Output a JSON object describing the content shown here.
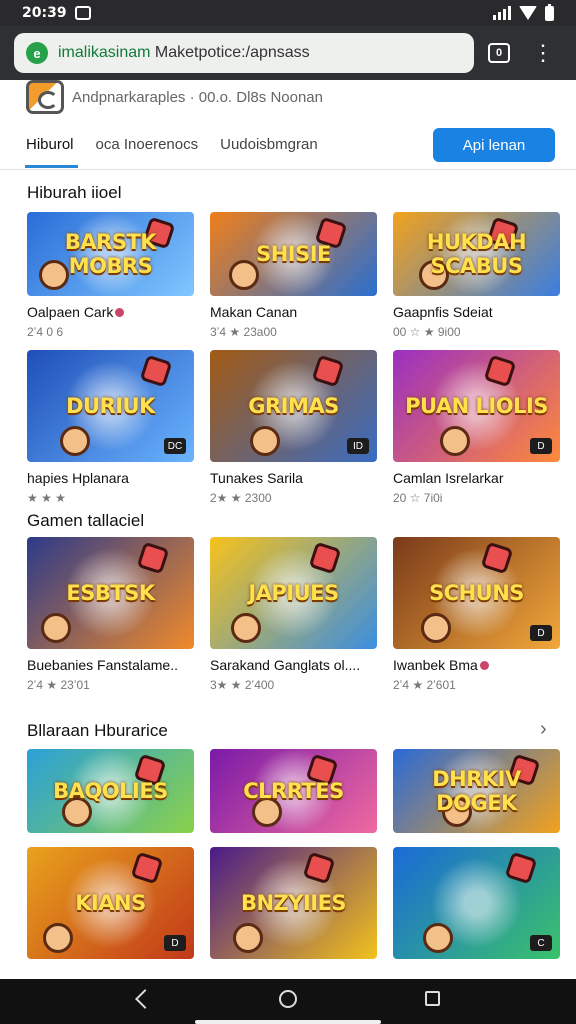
{
  "status": {
    "time": "20:39"
  },
  "browser": {
    "url_prefix": "imalikasinam",
    "url_rest": " Maketpotice:/apnsass",
    "tabs_count": "0"
  },
  "site": {
    "title": "Andpnarkaraples · 00.o. Dl8s  Noonan",
    "tabs": [
      "Hiburol",
      "oca Inoerenocs",
      "Uudoisbmgran"
    ],
    "active_tab": 0,
    "apply_label": "Api lenan"
  },
  "sections": [
    {
      "title": "Hiburah iioel"
    },
    {
      "title": "Gamen tallaciel"
    },
    {
      "title": "Bllaraan Hburarice",
      "arrow": "›"
    }
  ],
  "cards": [
    {
      "art": "BARSTK MOBRS",
      "name": "Oalpaen Cark",
      "meta": "2ʼ4 0 6",
      "dot": true,
      "colors": [
        "#2a6cd8",
        "#7fc8ff"
      ]
    },
    {
      "art": "SHISIE",
      "name": "Makan Canan",
      "meta": "3ʼ4  ★ 23a00",
      "colors": [
        "#f07e1a",
        "#2a6fd0"
      ]
    },
    {
      "art": "HUKDAH SCABUS",
      "name": "Gaapnfis Sdeiat",
      "meta": "00 ☆ ★ 9i00",
      "colors": [
        "#f2a21c",
        "#3a7de0"
      ]
    },
    {
      "art": "DURIUK",
      "name": "hapies Hplanara",
      "meta": "★ ★ ★",
      "badge": "DC",
      "colors": [
        "#1f4fb8",
        "#6ab4ff"
      ]
    },
    {
      "art": "GRIMAS",
      "name": "Tunakes Sarila",
      "meta": "2★ ★ 2300",
      "badge": "ID",
      "colors": [
        "#a35a14",
        "#3a6cc2"
      ]
    },
    {
      "art": "PUAN LIOLIS",
      "name": "Camlan Isrelarkar",
      "meta": "20 ☆ 7i0i",
      "badge": "D",
      "colors": [
        "#9a2fc2",
        "#ff8a3a"
      ]
    },
    {
      "art": "ESBTSK",
      "name": "Buebanies Fanstalame..",
      "meta": "2ʼ4  ★ 23ʼ01",
      "colors": [
        "#2c3a8a",
        "#f08a2a"
      ]
    },
    {
      "art": "JAPIUES",
      "name": "Sarakand Ganglats ol....",
      "meta": "3★ ★ 2ʼ400",
      "colors": [
        "#f7c21c",
        "#3b8ee0"
      ]
    },
    {
      "art": "SCHUNS",
      "name": "Iwanbek Bma",
      "meta": "2ʼ4  ★ 2ʼ601",
      "badge": "D",
      "dot": true,
      "colors": [
        "#7a3a1a",
        "#f2a83a"
      ]
    },
    {
      "art": "BAQOLIES",
      "name": "",
      "meta": "",
      "colors": [
        "#2aa0d8",
        "#8ad14a"
      ]
    },
    {
      "art": "CLRRTES",
      "name": "",
      "meta": "",
      "colors": [
        "#7a1aa8",
        "#f06aa0"
      ]
    },
    {
      "art": "DHRKIV DOGEK",
      "name": "",
      "meta": "",
      "colors": [
        "#2a6ad8",
        "#f2a21c"
      ]
    },
    {
      "art": "KIANS",
      "name": "",
      "meta": "",
      "badge": "D",
      "colors": [
        "#e8a21c",
        "#c2381a"
      ]
    },
    {
      "art": "BNZYIIES",
      "name": "",
      "meta": "",
      "colors": [
        "#4a1a8a",
        "#f2c21c"
      ]
    },
    {
      "art": "",
      "name": "",
      "meta": "",
      "badge": "C",
      "colors": [
        "#1a6ad8",
        "#3ac26a"
      ]
    }
  ]
}
